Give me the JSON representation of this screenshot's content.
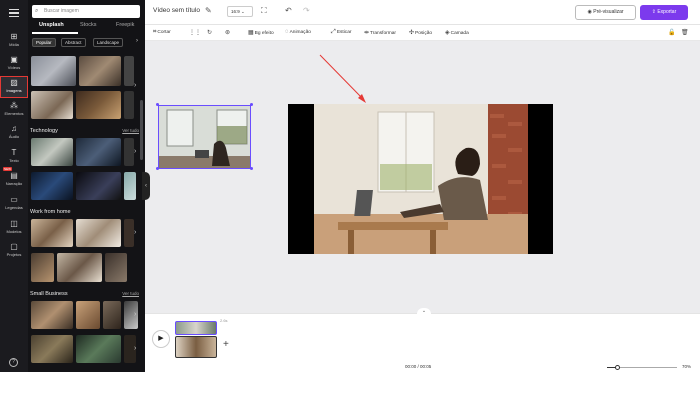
{
  "sidebar": {
    "menu_icon": "hamburger-icon",
    "items": [
      {
        "label": "Mídia",
        "icon": "media-icon"
      },
      {
        "label": "Vídeos",
        "icon": "video-icon"
      },
      {
        "label": "Imagens",
        "icon": "image-icon"
      },
      {
        "label": "Elementos",
        "icon": "elements-icon"
      },
      {
        "label": "Áudio",
        "icon": "music-icon"
      },
      {
        "label": "Texto",
        "icon": "text-icon"
      },
      {
        "label": "Narração",
        "icon": "narration-icon",
        "badge": "NEW"
      },
      {
        "label": "Legendas",
        "icon": "captions-icon"
      },
      {
        "label": "Modelos",
        "icon": "templates-icon"
      },
      {
        "label": "Projetos",
        "icon": "folder-icon"
      }
    ],
    "help_icon": "help-icon"
  },
  "library": {
    "search_placeholder": "Buscar imagem",
    "tabs": [
      "Unsplash",
      "Stocks",
      "Freepik"
    ],
    "chips": [
      "Popular",
      "Abstract",
      "Landscape"
    ],
    "sections": [
      {
        "title": "Technology",
        "see_all": "Ver tudo"
      },
      {
        "title": "Work from home",
        "see_all": "Ver tudo"
      },
      {
        "title": "Small Business",
        "see_all": "Ver tudo"
      }
    ]
  },
  "topbar": {
    "title": "Vídeo sem título",
    "ratio": "16:9",
    "preview_label": "Pré-visualizar",
    "export_label": "Exportar"
  },
  "toolbar": {
    "tools": [
      "Cortar",
      "Bg efeito",
      "Animação",
      "Esticar",
      "Transformar",
      "Posição",
      "Camada"
    ]
  },
  "timeline": {
    "clip_time": "2.6s",
    "current_time": "00:00 / 00:05",
    "zoom": "70%",
    "zoom_level": 0.15
  },
  "colors": {
    "accent": "#7c3aed",
    "highlight": "#e53935",
    "selection": "#6a4dff"
  }
}
